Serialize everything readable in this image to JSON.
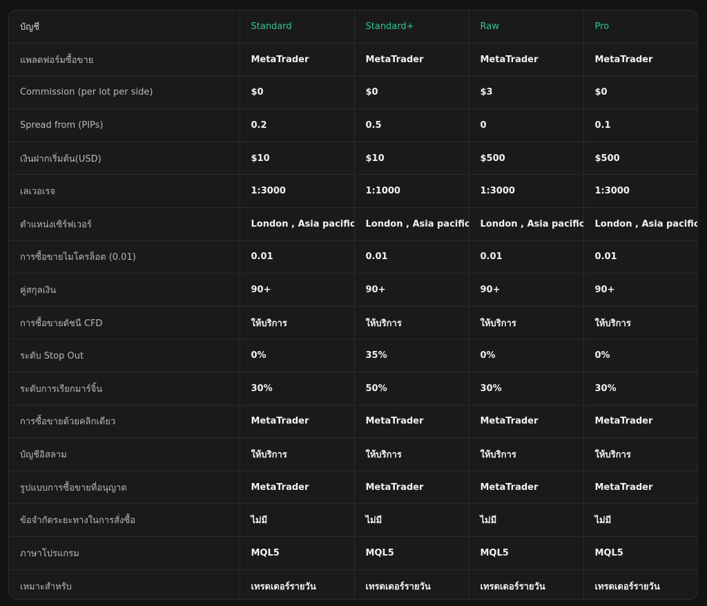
{
  "columns": [
    "บัญชี",
    "Standard",
    "Standard+",
    "Raw",
    "Pro"
  ],
  "rows": [
    {
      "label": "แพลตฟอร์มซื้อขาย",
      "values": [
        "MetaTrader",
        "MetaTrader",
        "MetaTrader",
        "MetaTrader"
      ]
    },
    {
      "label": "Commission (per lot per side)",
      "values": [
        "$0",
        "$0",
        "$3",
        "$0"
      ]
    },
    {
      "label": "Spread from (PIPs)",
      "values": [
        "0.2",
        "0.5",
        "0",
        "0.1"
      ]
    },
    {
      "label": "เงินฝากเริ่มต้น(USD)",
      "values": [
        "$10",
        "$10",
        "$500",
        "$500"
      ]
    },
    {
      "label": "เลเวอเรจ",
      "values": [
        "1:3000",
        "1:1000",
        "1:3000",
        "1:3000"
      ]
    },
    {
      "label": "ตำแหน่งเซิร์ฟเวอร์",
      "values": [
        "London , Asia pacific",
        "London , Asia pacific",
        "London , Asia pacific",
        "London , Asia pacific"
      ]
    },
    {
      "label": "การซื้อขายไมโครล็อต (0.01)",
      "values": [
        "0.01",
        "0.01",
        "0.01",
        "0.01"
      ]
    },
    {
      "label": "คู่สกุลเงิน",
      "values": [
        "90+",
        "90+",
        "90+",
        "90+"
      ]
    },
    {
      "label": "การซื้อขายดัชนี CFD",
      "values": [
        "ให้บริการ",
        "ให้บริการ",
        "ให้บริการ",
        "ให้บริการ"
      ]
    },
    {
      "label": "ระดับ Stop Out",
      "values": [
        "0%",
        "35%",
        "0%",
        "0%"
      ]
    },
    {
      "label": "ระดับการเรียกมาร์จิ้น",
      "values": [
        "30%",
        "50%",
        "30%",
        "30%"
      ]
    },
    {
      "label": "การซื้อขายด้วยคลิกเดียว",
      "values": [
        "MetaTrader",
        "MetaTrader",
        "MetaTrader",
        "MetaTrader"
      ]
    },
    {
      "label": "บัญชีอิสลาม",
      "values": [
        "ให้บริการ",
        "ให้บริการ",
        "ให้บริการ",
        "ให้บริการ"
      ]
    },
    {
      "label": "รูปแบบการซื้อขายที่อนุญาต",
      "values": [
        "MetaTrader",
        "MetaTrader",
        "MetaTrader",
        "MetaTrader"
      ]
    },
    {
      "label": "ข้อจำกัดระยะทางในการสั่งซื้อ",
      "values": [
        "ไม่มี",
        "ไม่มี",
        "ไม่มี",
        "ไม่มี"
      ]
    },
    {
      "label": "ภาษาโปรแกรม",
      "values": [
        "MQL5",
        "MQL5",
        "MQL5",
        "MQL5"
      ]
    },
    {
      "label": "เหมาะสำหรับ",
      "values": [
        "เทรดเดอร์รายวัน",
        "เทรดเดอร์รายวัน",
        "เทรดเดอร์รายวัน",
        "เทรดเดอร์รายวัน"
      ]
    }
  ],
  "colors": {
    "accent": "#2fc79a",
    "background": "#1a1a1a",
    "border": "#2a2a2a"
  }
}
